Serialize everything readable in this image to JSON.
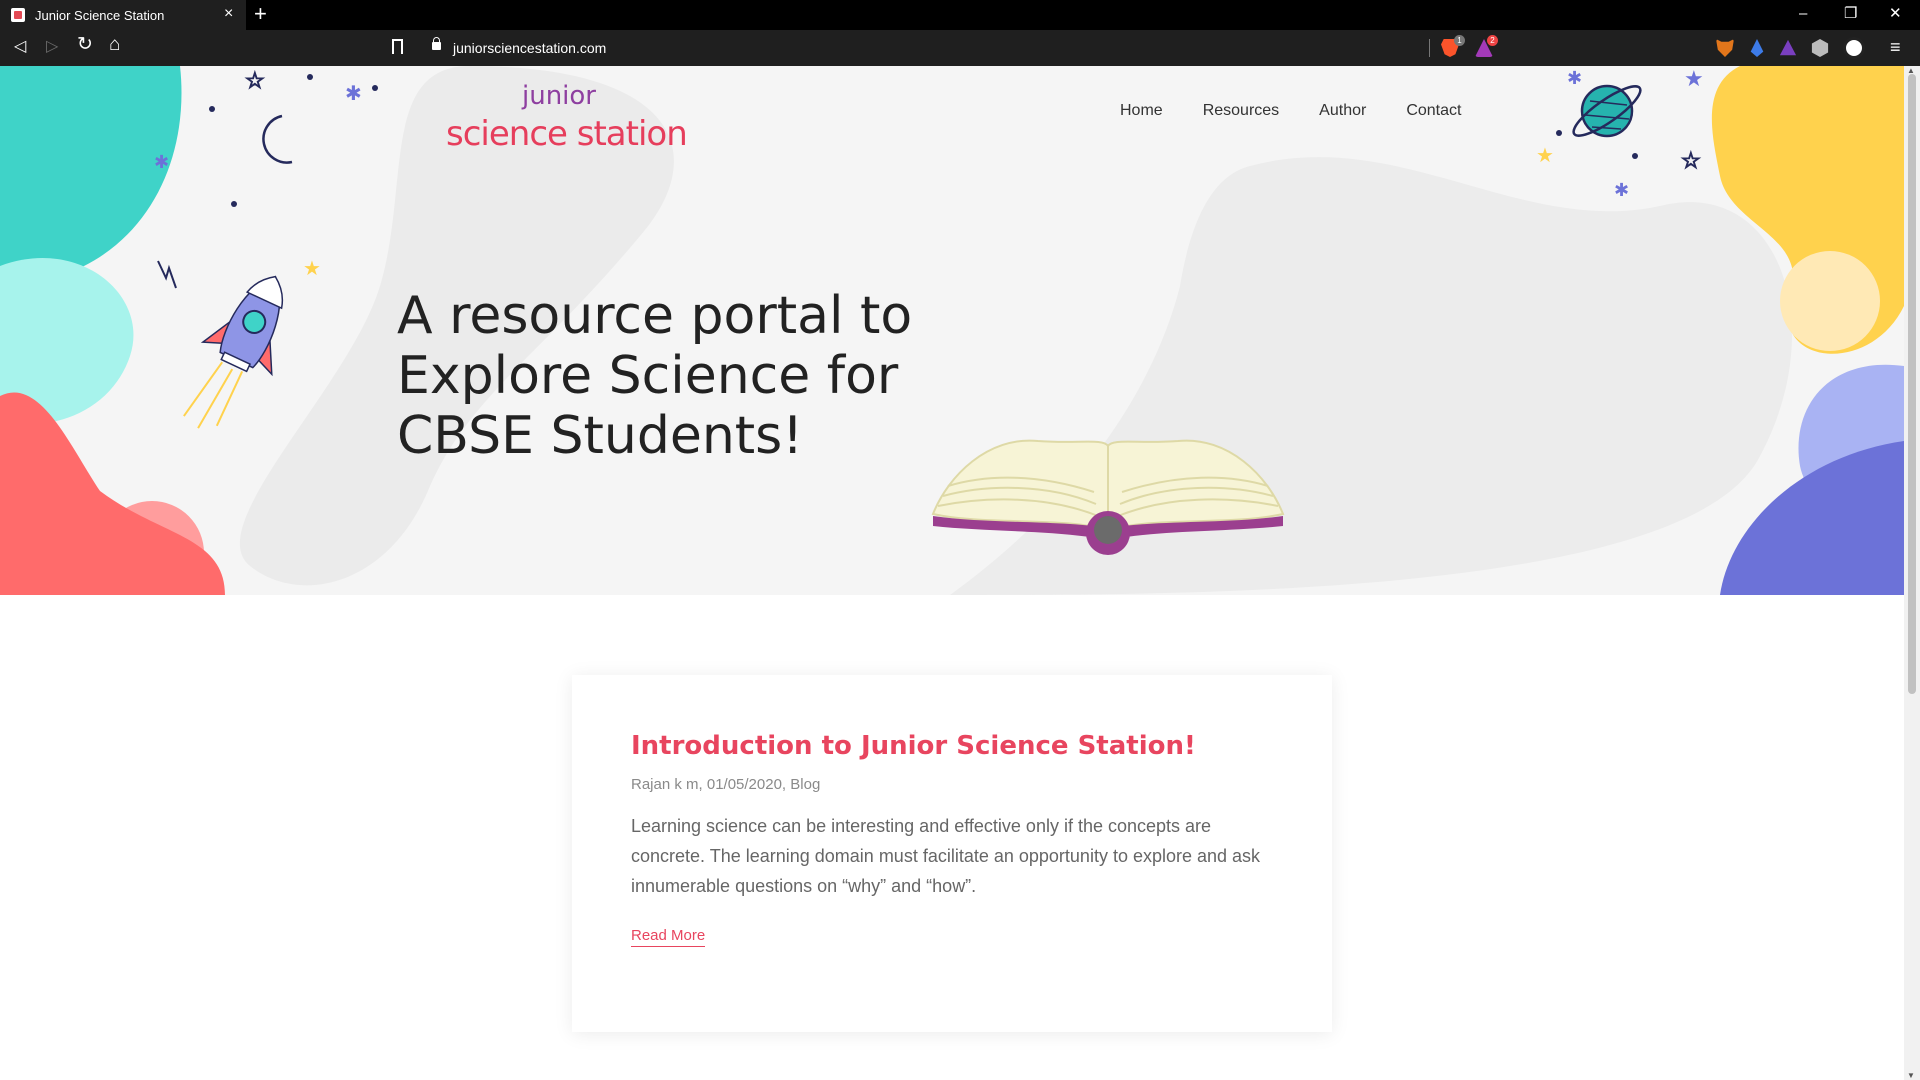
{
  "browser": {
    "tab_title": "Junior Science Station",
    "tab_close": "×",
    "new_tab": "+",
    "url": "juniorsciencestation.com",
    "window_controls": {
      "minimize": "–",
      "restore": "❐",
      "close": "✕"
    },
    "nav": {
      "back": "◁",
      "forward": "▷",
      "reload": "↻",
      "home": "⌂"
    },
    "extensions": [
      {
        "icon": "brave-shield-icon",
        "color": "#fb542b",
        "badge": "1"
      },
      {
        "icon": "brave-rewards-icon",
        "color": "#a33ab8",
        "badge": "2"
      },
      {
        "icon": "metamask-icon",
        "color": "#e2761b"
      },
      {
        "icon": "drop-icon",
        "color": "#3d7be8"
      },
      {
        "icon": "triangle-icon",
        "color": "#7a3fc0"
      },
      {
        "icon": "cube-icon",
        "color": "#bbbbbb"
      },
      {
        "icon": "glasses-icon",
        "color": "#ffffff"
      }
    ],
    "menu": "≡"
  },
  "site": {
    "logo": {
      "line1": "junior",
      "line2": "science station"
    },
    "nav": [
      "Home",
      "Resources",
      "Author",
      "Contact"
    ],
    "headline": "A resource portal to Explore Science for CBSE Students!",
    "colors": {
      "accent": "#e8455f",
      "teal": "#3fd3c8",
      "coral": "#ff6b6b",
      "yellow": "#ffd24d",
      "indigo": "#6c72d8",
      "hero_bg": "#f5f5f5"
    }
  },
  "post": {
    "title": "Introduction to Junior Science Station!",
    "meta": "Rajan k m, 01/05/2020, Blog",
    "excerpt": "Learning science can be interesting and effective only if the concepts are concrete. The learning domain must facilitate an opportunity to explore and ask innumerable questions on “why” and “how”.",
    "read_more": "Read More"
  }
}
